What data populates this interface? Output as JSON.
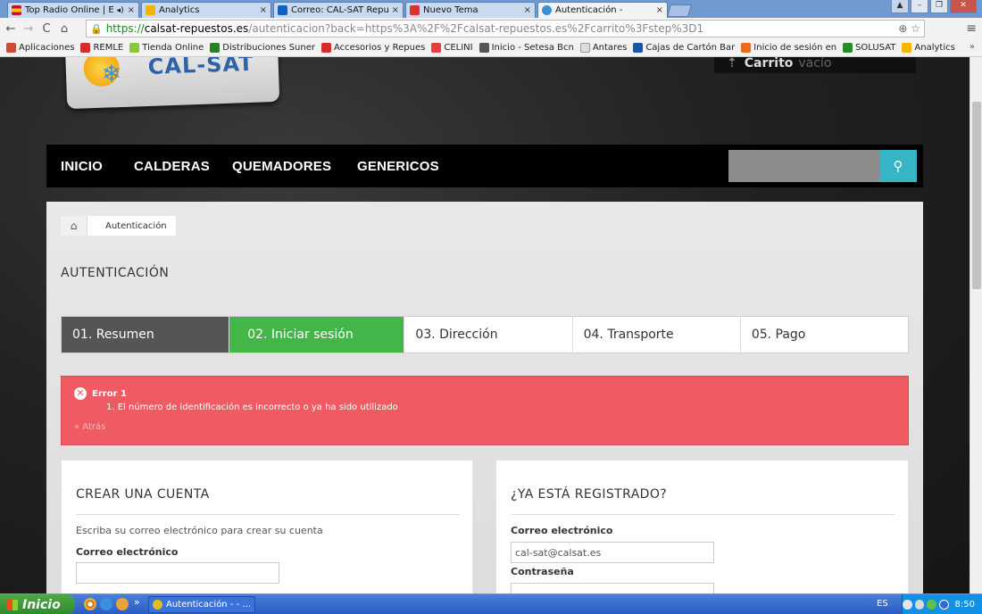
{
  "browser": {
    "tabs": [
      {
        "label": "Top Radio Online | E",
        "color": "#c8102e"
      },
      {
        "label": "Analytics",
        "color": "#f4b400"
      },
      {
        "label": "Correo: CAL-SAT Repu",
        "color": "#0a64c8"
      },
      {
        "label": "Nuevo Tema",
        "color": "#d9342b"
      },
      {
        "label": "Autenticación -",
        "color": "#3d8fd6"
      }
    ],
    "url": {
      "scheme": "https://",
      "host": "calsat-repuestos.es",
      "path": "/autenticacion?back=https%3A%2F%2Fcalsat-repuestos.es%2Fcarrito%3Fstep%3D1"
    },
    "bookmarks": [
      {
        "label": "Aplicaciones",
        "color": "#d04a3a"
      },
      {
        "label": "REMLE",
        "color": "#d62b2b"
      },
      {
        "label": "Tienda Online",
        "color": "#8cc63e"
      },
      {
        "label": "Distribuciones Suner",
        "color": "#2a7f2a"
      },
      {
        "label": "Accesorios y Repues",
        "color": "#d62b2b"
      },
      {
        "label": "CELINI",
        "color": "#e04040"
      },
      {
        "label": "Inicio - Setesa Bcn",
        "color": "#555555"
      },
      {
        "label": "Antares",
        "color": "#999999"
      },
      {
        "label": "Cajas de Cartón Bar",
        "color": "#1a56a8"
      },
      {
        "label": "Inicio de sesión en",
        "color": "#e86a1a"
      },
      {
        "label": "SOLUSAT",
        "color": "#2a8a2a"
      },
      {
        "label": "Analytics",
        "color": "#f4b400"
      }
    ],
    "more": "»"
  },
  "site": {
    "logo_text": "CAL-SAT",
    "cart": {
      "label": "Carrito",
      "status": "vacío"
    },
    "nav": [
      "INICIO",
      "CALDERAS",
      "QUEMADORES",
      "GENERICOS"
    ],
    "search_icon": "search-icon"
  },
  "breadcrumb": {
    "home_icon": "home-icon",
    "current": "Autenticación"
  },
  "page_title": "AUTENTICACIÓN",
  "steps": [
    {
      "label": "01. Resumen",
      "state": "done"
    },
    {
      "label": "02. Iniciar sesión",
      "state": "current"
    },
    {
      "label": "03. Dirección",
      "state": "pending"
    },
    {
      "label": "04. Transporte",
      "state": "pending"
    },
    {
      "label": "05. Pago",
      "state": "pending"
    }
  ],
  "alert": {
    "title": "Error 1",
    "message": "1. El número de identificación es incorrecto o ya ha sido utilizado",
    "back": "« Atrás"
  },
  "create_account": {
    "title": "CREAR UNA CUENTA",
    "description": "Escriba su correo electrónico para crear su cuenta",
    "email_label": "Correo electrónico",
    "email_value": ""
  },
  "login": {
    "title": "¿YA ESTÁ REGISTRADO?",
    "email_label": "Correo electrónico",
    "email_value": "cal-sat@calsat.es",
    "password_label": "Contraseña",
    "password_value": ""
  },
  "taskbar": {
    "start": "Inicio",
    "task_label": "Autenticación - - ...",
    "lang": "ES",
    "time": "8:50"
  }
}
